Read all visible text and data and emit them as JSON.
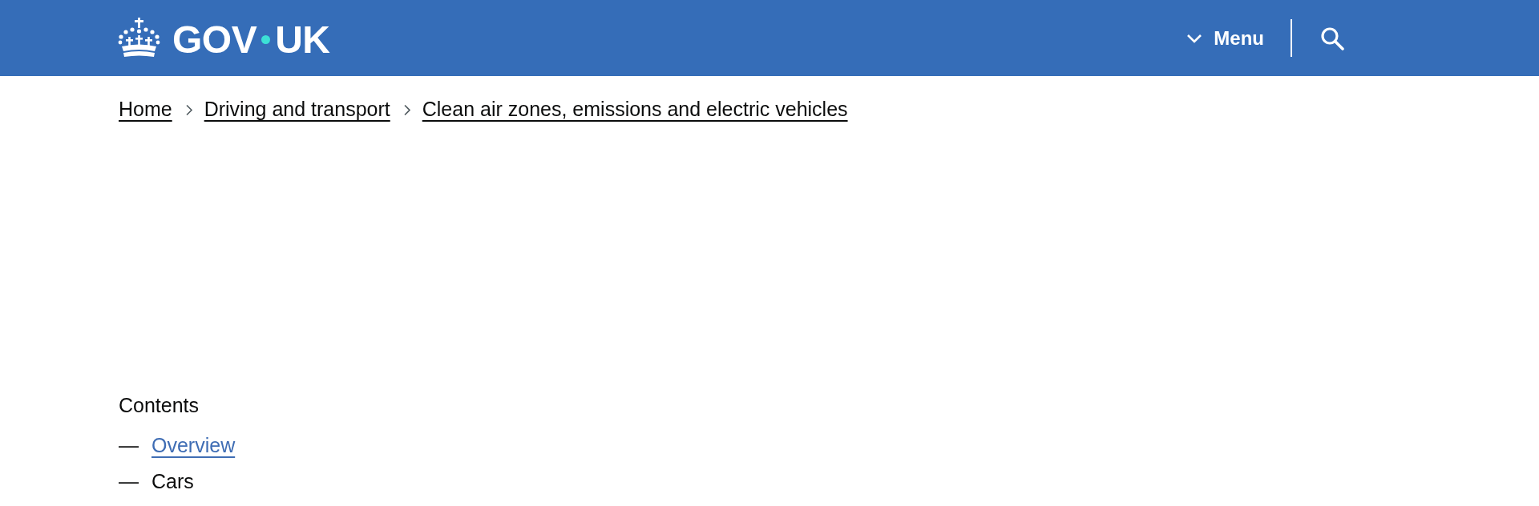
{
  "header": {
    "logo": {
      "text_before_dot": "GOV",
      "text_after_dot": "UK"
    },
    "menu_button": {
      "label": "Menu",
      "expanded": false
    }
  },
  "breadcrumbs": [
    {
      "label": "Home"
    },
    {
      "label": "Driving and transport"
    },
    {
      "label": "Clean air zones, emissions and electric vehicles"
    }
  ],
  "contents": {
    "heading": "Contents",
    "items": [
      {
        "dash": "—",
        "label": "Overview",
        "selected": false
      },
      {
        "dash": "—",
        "label": "Cars",
        "selected": true
      }
    ]
  }
}
